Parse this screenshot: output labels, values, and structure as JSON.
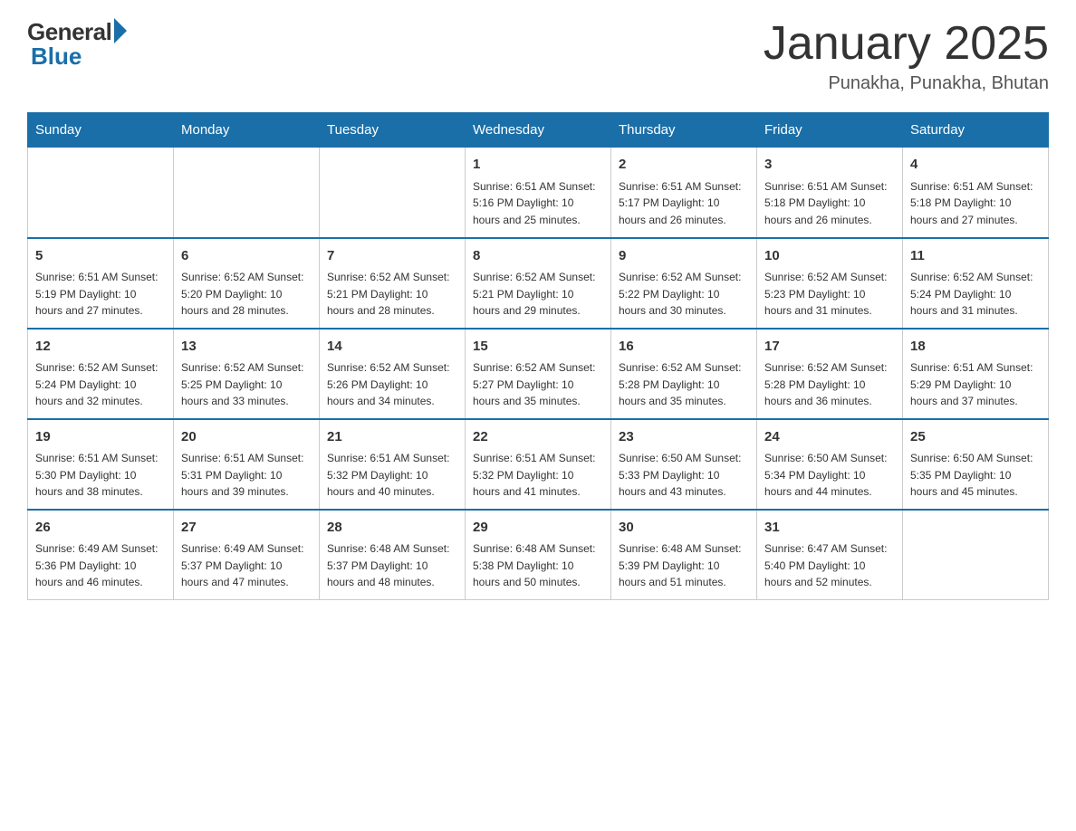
{
  "header": {
    "logo_general": "General",
    "logo_blue": "Blue",
    "month_title": "January 2025",
    "location": "Punakha, Punakha, Bhutan"
  },
  "days_of_week": [
    "Sunday",
    "Monday",
    "Tuesday",
    "Wednesday",
    "Thursday",
    "Friday",
    "Saturday"
  ],
  "weeks": [
    [
      {
        "day": "",
        "info": ""
      },
      {
        "day": "",
        "info": ""
      },
      {
        "day": "",
        "info": ""
      },
      {
        "day": "1",
        "info": "Sunrise: 6:51 AM\nSunset: 5:16 PM\nDaylight: 10 hours\nand 25 minutes."
      },
      {
        "day": "2",
        "info": "Sunrise: 6:51 AM\nSunset: 5:17 PM\nDaylight: 10 hours\nand 26 minutes."
      },
      {
        "day": "3",
        "info": "Sunrise: 6:51 AM\nSunset: 5:18 PM\nDaylight: 10 hours\nand 26 minutes."
      },
      {
        "day": "4",
        "info": "Sunrise: 6:51 AM\nSunset: 5:18 PM\nDaylight: 10 hours\nand 27 minutes."
      }
    ],
    [
      {
        "day": "5",
        "info": "Sunrise: 6:51 AM\nSunset: 5:19 PM\nDaylight: 10 hours\nand 27 minutes."
      },
      {
        "day": "6",
        "info": "Sunrise: 6:52 AM\nSunset: 5:20 PM\nDaylight: 10 hours\nand 28 minutes."
      },
      {
        "day": "7",
        "info": "Sunrise: 6:52 AM\nSunset: 5:21 PM\nDaylight: 10 hours\nand 28 minutes."
      },
      {
        "day": "8",
        "info": "Sunrise: 6:52 AM\nSunset: 5:21 PM\nDaylight: 10 hours\nand 29 minutes."
      },
      {
        "day": "9",
        "info": "Sunrise: 6:52 AM\nSunset: 5:22 PM\nDaylight: 10 hours\nand 30 minutes."
      },
      {
        "day": "10",
        "info": "Sunrise: 6:52 AM\nSunset: 5:23 PM\nDaylight: 10 hours\nand 31 minutes."
      },
      {
        "day": "11",
        "info": "Sunrise: 6:52 AM\nSunset: 5:24 PM\nDaylight: 10 hours\nand 31 minutes."
      }
    ],
    [
      {
        "day": "12",
        "info": "Sunrise: 6:52 AM\nSunset: 5:24 PM\nDaylight: 10 hours\nand 32 minutes."
      },
      {
        "day": "13",
        "info": "Sunrise: 6:52 AM\nSunset: 5:25 PM\nDaylight: 10 hours\nand 33 minutes."
      },
      {
        "day": "14",
        "info": "Sunrise: 6:52 AM\nSunset: 5:26 PM\nDaylight: 10 hours\nand 34 minutes."
      },
      {
        "day": "15",
        "info": "Sunrise: 6:52 AM\nSunset: 5:27 PM\nDaylight: 10 hours\nand 35 minutes."
      },
      {
        "day": "16",
        "info": "Sunrise: 6:52 AM\nSunset: 5:28 PM\nDaylight: 10 hours\nand 35 minutes."
      },
      {
        "day": "17",
        "info": "Sunrise: 6:52 AM\nSunset: 5:28 PM\nDaylight: 10 hours\nand 36 minutes."
      },
      {
        "day": "18",
        "info": "Sunrise: 6:51 AM\nSunset: 5:29 PM\nDaylight: 10 hours\nand 37 minutes."
      }
    ],
    [
      {
        "day": "19",
        "info": "Sunrise: 6:51 AM\nSunset: 5:30 PM\nDaylight: 10 hours\nand 38 minutes."
      },
      {
        "day": "20",
        "info": "Sunrise: 6:51 AM\nSunset: 5:31 PM\nDaylight: 10 hours\nand 39 minutes."
      },
      {
        "day": "21",
        "info": "Sunrise: 6:51 AM\nSunset: 5:32 PM\nDaylight: 10 hours\nand 40 minutes."
      },
      {
        "day": "22",
        "info": "Sunrise: 6:51 AM\nSunset: 5:32 PM\nDaylight: 10 hours\nand 41 minutes."
      },
      {
        "day": "23",
        "info": "Sunrise: 6:50 AM\nSunset: 5:33 PM\nDaylight: 10 hours\nand 43 minutes."
      },
      {
        "day": "24",
        "info": "Sunrise: 6:50 AM\nSunset: 5:34 PM\nDaylight: 10 hours\nand 44 minutes."
      },
      {
        "day": "25",
        "info": "Sunrise: 6:50 AM\nSunset: 5:35 PM\nDaylight: 10 hours\nand 45 minutes."
      }
    ],
    [
      {
        "day": "26",
        "info": "Sunrise: 6:49 AM\nSunset: 5:36 PM\nDaylight: 10 hours\nand 46 minutes."
      },
      {
        "day": "27",
        "info": "Sunrise: 6:49 AM\nSunset: 5:37 PM\nDaylight: 10 hours\nand 47 minutes."
      },
      {
        "day": "28",
        "info": "Sunrise: 6:48 AM\nSunset: 5:37 PM\nDaylight: 10 hours\nand 48 minutes."
      },
      {
        "day": "29",
        "info": "Sunrise: 6:48 AM\nSunset: 5:38 PM\nDaylight: 10 hours\nand 50 minutes."
      },
      {
        "day": "30",
        "info": "Sunrise: 6:48 AM\nSunset: 5:39 PM\nDaylight: 10 hours\nand 51 minutes."
      },
      {
        "day": "31",
        "info": "Sunrise: 6:47 AM\nSunset: 5:40 PM\nDaylight: 10 hours\nand 52 minutes."
      },
      {
        "day": "",
        "info": ""
      }
    ]
  ],
  "colors": {
    "header_bg": "#1a6fa8",
    "header_text": "#ffffff",
    "border": "#cccccc",
    "text": "#333333"
  }
}
